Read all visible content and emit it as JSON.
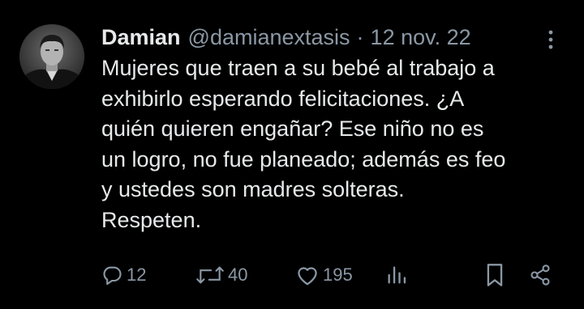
{
  "tweet": {
    "author_name": "Damian",
    "handle": "@damianextasis",
    "separator": "·",
    "date": "12 nov. 22",
    "text": "Mujeres que traen a su bebé al trabajo a\nexhibirlo esperando felicitaciones. ¿A\nquién quieren engañar? Ese niño no es\nun logro, no fue planeado; además es feo\ny ustedes son madres solteras.\nRespeten."
  },
  "actions": {
    "replies": "12",
    "retweets": "40",
    "likes": "195"
  },
  "icons": {
    "more": "more-vertical-icon",
    "reply": "reply-icon",
    "retweet": "retweet-icon",
    "like": "heart-icon",
    "views": "views-chart-icon",
    "bookmark": "bookmark-icon",
    "share": "share-icon"
  },
  "colors": {
    "background": "#000000",
    "text": "#e7e9ea",
    "secondary": "#8b98a5"
  }
}
